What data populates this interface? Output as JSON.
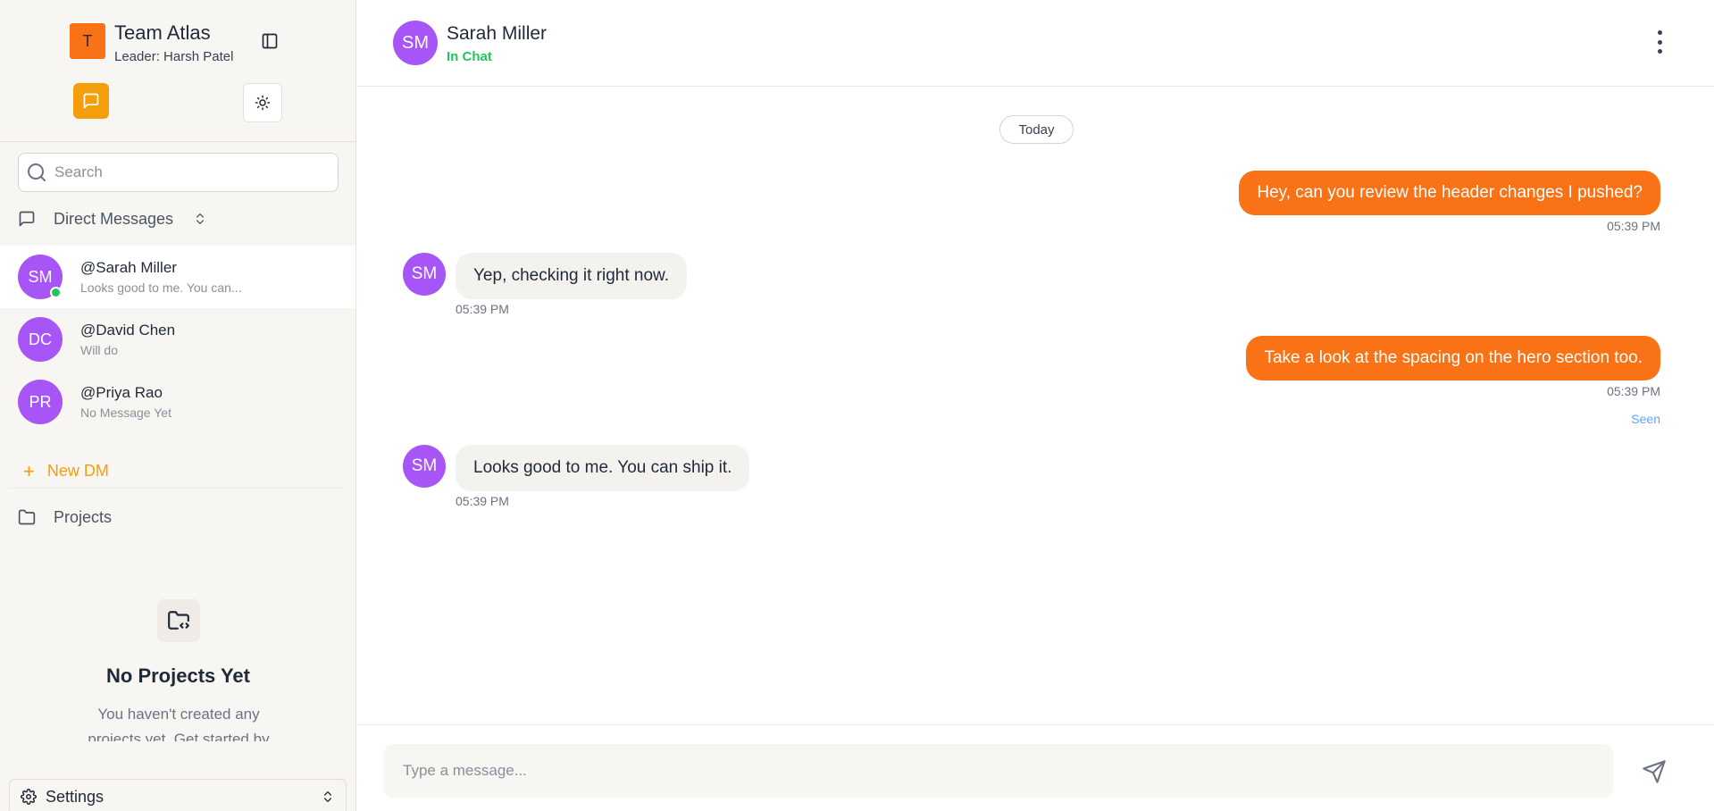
{
  "team": {
    "initial": "T",
    "name": "Team Atlas",
    "leader": "Leader: Harsh Patel"
  },
  "sidebar": {
    "search_placeholder": "Search",
    "direct_messages_label": "Direct Messages",
    "dms": [
      {
        "initials": "SM",
        "name": "@Sarah Miller",
        "preview": "Looks good to me. You can...",
        "online": true,
        "active": true
      },
      {
        "initials": "DC",
        "name": "@David Chen",
        "preview": "Will do",
        "online": false,
        "active": false
      },
      {
        "initials": "PR",
        "name": "@Priya Rao",
        "preview": "No Message Yet",
        "online": false,
        "active": false
      }
    ],
    "new_dm_label": "New DM",
    "projects_label": "Projects",
    "empty_projects": {
      "title": "No Projects Yet",
      "description": "You haven't created any projects yet. Get started by"
    },
    "settings_label": "Settings"
  },
  "chat": {
    "contact_initials": "SM",
    "contact_name": "Sarah Miller",
    "contact_status": "In Chat",
    "date_divider": "Today",
    "messages": [
      {
        "direction": "out",
        "text": "Hey, can you review the header changes I pushed?",
        "time": "05:39 PM"
      },
      {
        "direction": "in",
        "initials": "SM",
        "text": "Yep, checking it right now.",
        "time": "05:39 PM"
      },
      {
        "direction": "out",
        "text": "Take a look at the spacing on the hero section too.",
        "time": "05:39 PM",
        "status": "Seen"
      },
      {
        "direction": "in",
        "initials": "SM",
        "text": "Looks good to me. You can ship it.",
        "time": "05:39 PM"
      }
    ],
    "composer_placeholder": "Type a message..."
  },
  "colors": {
    "accent_orange": "#f97316",
    "accent_amber": "#f59e0b",
    "avatar_purple": "#a855f7",
    "online_green": "#22c55e",
    "seen_blue": "#60a5fa"
  },
  "icons": {
    "collapse": "sidebar-toggle-icon",
    "chat_mode": "message-square-icon",
    "theme": "sun-icon",
    "search": "search-icon",
    "direct_messages": "message-square-icon",
    "sort": "chevrons-up-down-icon",
    "new_dm": "plus-icon",
    "projects": "folder-icon",
    "empty_projects": "folder-code-icon",
    "settings": "gear-icon",
    "menu": "more-vertical-icon",
    "send": "send-icon"
  }
}
